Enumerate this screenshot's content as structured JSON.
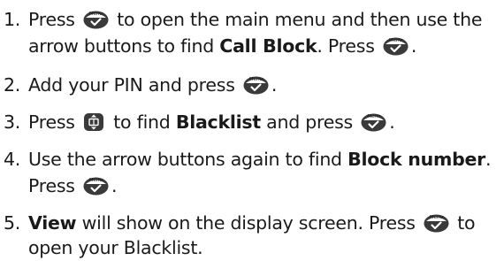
{
  "icons": {
    "menu_key": "menu-ok-key-icon",
    "arrow_key": "phonebook-arrow-key-icon",
    "menu_key_word": "Menu"
  },
  "colors": {
    "text": "#1a1a1a",
    "key_fill": "#3a3a3a"
  },
  "steps": [
    {
      "num": "1.",
      "l1_a": "Press",
      "l1_b": "to open the main menu and then use the",
      "l2_a": "arrow buttons to find",
      "l2_bold": "Call Block",
      "l2_c": ". Press",
      "l2_end": "."
    },
    {
      "num": "2.",
      "l1_a": "Add your PIN and press",
      "l1_end": "."
    },
    {
      "num": "3.",
      "l1_a": "Press",
      "l1_b": "to find",
      "l1_bold": "Blacklist",
      "l1_c": "and press",
      "l1_end": "."
    },
    {
      "num": "4.",
      "l1_a": "Use the arrow buttons again to find",
      "l1_bold": "Block number",
      "l1_end": ".",
      "l2_a": "Press",
      "l2_end": "."
    },
    {
      "num": "5.",
      "l1_bold": "View",
      "l1_a": "will show on the display screen. Press",
      "l1_b": "to",
      "l2_a": "open your Blacklist."
    }
  ]
}
